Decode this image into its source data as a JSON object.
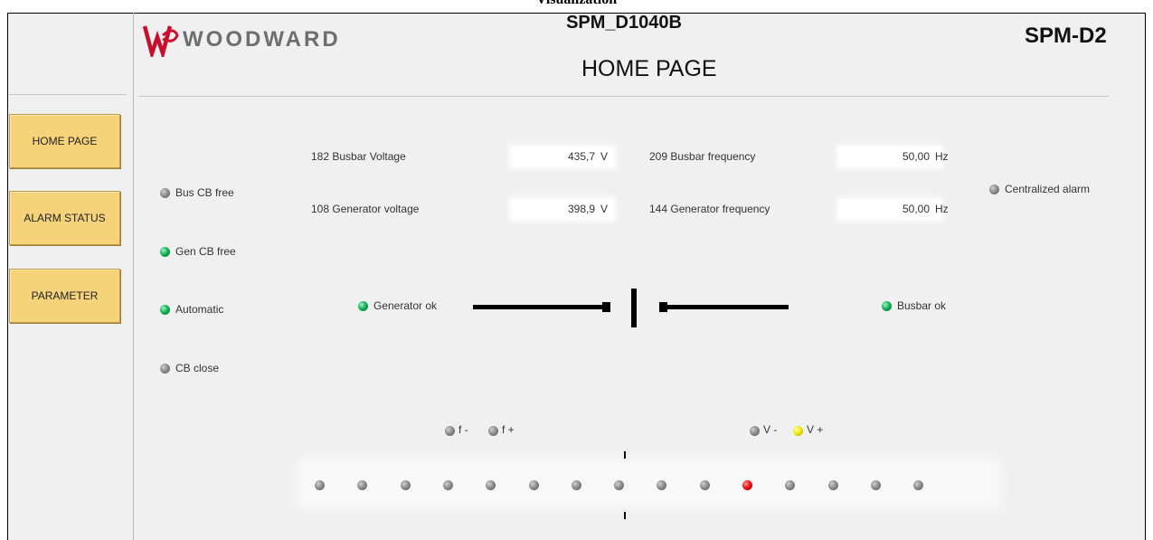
{
  "document": {
    "heading": "Visualization"
  },
  "header": {
    "brand": "WOODWARD",
    "device_id": "SPM_D1040B",
    "page_title": "HOME PAGE",
    "model": "SPM-D2"
  },
  "nav": [
    {
      "label": "HOME PAGE"
    },
    {
      "label": "ALARM STATUS"
    },
    {
      "label": "PARAMETER"
    }
  ],
  "status_lamps": [
    {
      "label": "Bus CB free",
      "state": "off"
    },
    {
      "label": "Gen CB free",
      "state": "on"
    },
    {
      "label": "Automatic",
      "state": "on"
    },
    {
      "label": "CB close",
      "state": "off"
    }
  ],
  "measurements": [
    {
      "label": "182 Busbar Voltage",
      "value": "435,7",
      "unit": "V"
    },
    {
      "label": "108 Generator voltage",
      "value": "398,9",
      "unit": "V"
    },
    {
      "label": "209 Busbar frequency",
      "value": "50,00",
      "unit": "Hz"
    },
    {
      "label": "144 Generator frequency",
      "value": "50,00",
      "unit": "Hz"
    }
  ],
  "indicators": {
    "centralized_alarm": {
      "label": "Centralized alarm",
      "state": "off"
    },
    "generator_ok": {
      "label": "Generator ok",
      "state": "on"
    },
    "busbar_ok": {
      "label": "Busbar ok",
      "state": "on"
    }
  },
  "adjust_lamps": {
    "f_minus": {
      "label": "f -",
      "state": "off"
    },
    "f_plus": {
      "label": "f +",
      "state": "off"
    },
    "v_minus": {
      "label": "V -",
      "state": "off"
    },
    "v_plus": {
      "label": "V +",
      "state": "yellow"
    }
  },
  "synchroscope": {
    "lamp_count": 15,
    "active_index": 10,
    "active_color": "#ee1010"
  },
  "colors": {
    "nav_button": "#f6d27a",
    "lamp_on": "#12b35a",
    "lamp_off": "#8e8e8e",
    "lamp_yellow": "#e8e800"
  }
}
